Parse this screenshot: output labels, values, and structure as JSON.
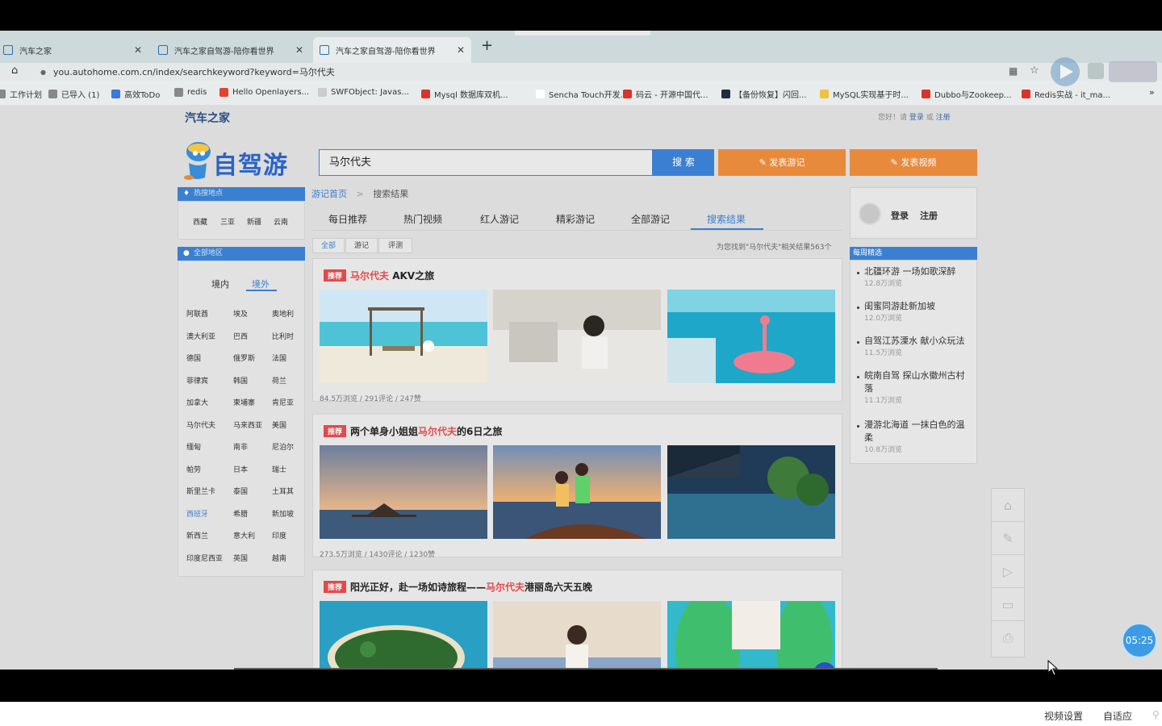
{
  "browser": {
    "tabs": [
      {
        "title": "汽车之家"
      },
      {
        "title": "汽车之家自驾游-陪你看世界"
      },
      {
        "title": "汽车之家自驾游-陪你看世界"
      }
    ],
    "url": "you.autohome.com.cn/index/searchkeyword?keyword=马尔代夫",
    "bookmarks": [
      {
        "label": "工作计划",
        "color": "#888888"
      },
      {
        "label": "已导入 (1)",
        "color": "#888888"
      },
      {
        "label": "高效ToDo",
        "color": "#3b78d8"
      },
      {
        "label": "redis",
        "color": "#888888"
      },
      {
        "label": "Hello Openlayers...",
        "color": "#e0452f"
      },
      {
        "label": "SWFObject: Javas...",
        "color": "#cccccc"
      },
      {
        "label": "Mysql 数据库双机...",
        "color": "#d9342b"
      },
      {
        "label": "Sencha Touch开发...",
        "color": "#ffffff"
      },
      {
        "label": "码云 - 开源中国代...",
        "color": "#d9342b"
      },
      {
        "label": "【备份恢复】闪回...",
        "color": "#1f2a44"
      },
      {
        "label": "MySQL实现基于时...",
        "color": "#f0c040"
      },
      {
        "label": "Dubbo与Zookeep...",
        "color": "#d9342b"
      },
      {
        "label": "Redis实战 - it_ma...",
        "color": "#d9342b"
      }
    ],
    "bookmarks_more": "»"
  },
  "header": {
    "site_name": "汽车之家",
    "greeting": "您好！请",
    "login": "登录",
    "or": "或",
    "register": "注册"
  },
  "logo_text": "自驾游",
  "search": {
    "value": "马尔代夫",
    "button": "搜 索"
  },
  "actions": {
    "post_travel": "发表游记",
    "post_video": "发表视频"
  },
  "sidebar": {
    "hot_title": "热搜地点",
    "hot_places": [
      "西藏",
      "三亚",
      "新疆",
      "云南"
    ],
    "all_title": "全部地区",
    "region_tabs": [
      "境内",
      "境外"
    ],
    "countries": [
      [
        "阿联酋",
        "埃及",
        "奥地利"
      ],
      [
        "澳大利亚",
        "巴西",
        "比利时"
      ],
      [
        "德国",
        "俄罗斯",
        "法国"
      ],
      [
        "菲律宾",
        "韩国",
        "荷兰"
      ],
      [
        "加拿大",
        "柬埔寨",
        "肯尼亚"
      ],
      [
        "马尔代夫",
        "马来西亚",
        "美国"
      ],
      [
        "缅甸",
        "南非",
        "尼泊尔"
      ],
      [
        "帕劳",
        "日本",
        "瑞士"
      ],
      [
        "斯里兰卡",
        "泰国",
        "土耳其"
      ],
      [
        "西班牙",
        "希腊",
        "新加坡"
      ],
      [
        "新西兰",
        "意大利",
        "印度"
      ],
      [
        "印度尼西亚",
        "英国",
        "越南"
      ]
    ]
  },
  "breadcrumb": {
    "home": "游记首页",
    "sep": ">",
    "current": "搜索结果"
  },
  "nav_tabs": [
    "每日推荐",
    "热门视频",
    "红人游记",
    "精彩游记",
    "全部游记",
    "搜索结果"
  ],
  "filters": [
    "全部",
    "游记",
    "评测"
  ],
  "result_count": "为您找到\"马尔代夫\"相关结果563个",
  "results": [
    {
      "tag": "推荐",
      "pre": "",
      "hl": "马尔代夫",
      "post": " AKV之旅",
      "meta": "84.5万浏览 / 291评论 / 247赞"
    },
    {
      "tag": "推荐",
      "pre": "两个单身小姐姐",
      "hl": "马尔代夫",
      "post": "的6日之旅",
      "meta": "273.5万浏览 / 1430评论 / 1230赞"
    },
    {
      "tag": "推荐",
      "pre": "阳光正好，赴一场如诗旅程——",
      "hl": "马尔代夫",
      "post": "港丽岛六天五晚",
      "meta": ""
    }
  ],
  "user_box": {
    "login": "登录",
    "register": "注册"
  },
  "weekly": {
    "title": "每周精选",
    "items": [
      {
        "title": "北疆环游 一场如歌深醉",
        "views": "12.8万浏览"
      },
      {
        "title": "闺蜜同游赴新加坡",
        "views": "12.0万浏览"
      },
      {
        "title": "自驾江苏溧水 献小众玩法",
        "views": "11.5万浏览"
      },
      {
        "title": "皖南自驾 探山水徽州古村落",
        "views": "11.1万浏览"
      },
      {
        "title": "漫游北海道 一抹白色的温柔",
        "views": "10.8万浏览"
      }
    ]
  },
  "player": {
    "timer": "05:25",
    "video_settings": "视频设置",
    "fit": "自适应"
  },
  "colors": {
    "accent": "#3b80d0",
    "orange": "#e88a3c",
    "highlight": "#e24a4a"
  }
}
